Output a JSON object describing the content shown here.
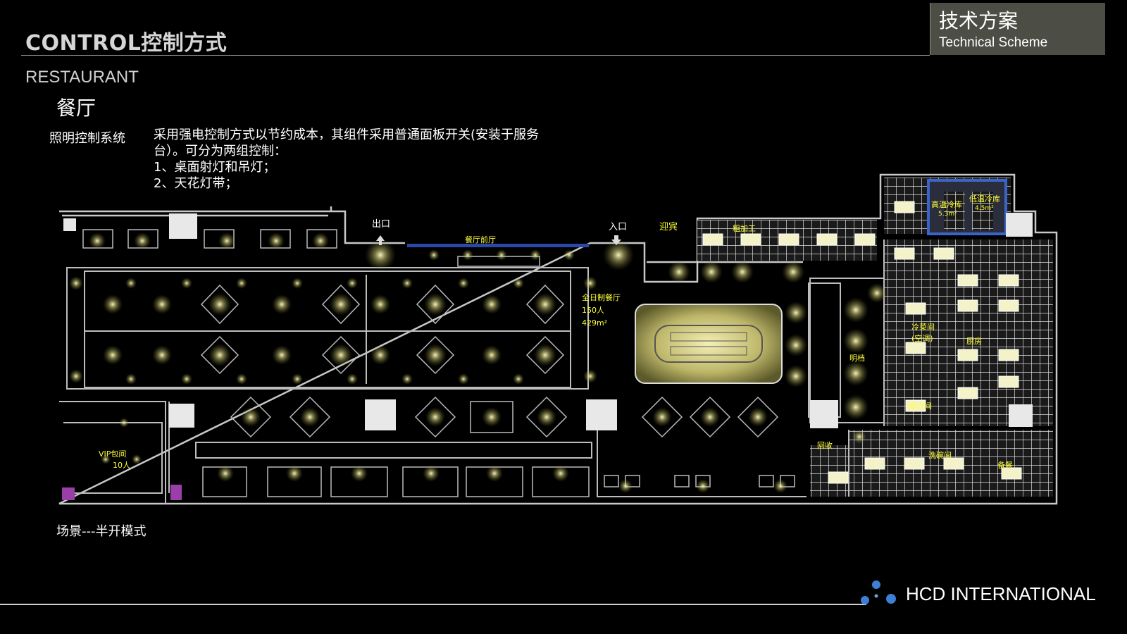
{
  "header": {
    "title": "CONTROL控制方式",
    "badge_cn": "技术方案",
    "badge_en": "Technical Scheme"
  },
  "section": {
    "en": "RESTAURANT",
    "cn": "餐厅"
  },
  "lighting": {
    "label": "照明控制系统",
    "lines": [
      "采用强电控制方式以节约成本，其组件采用普通面板开关(安装于服务",
      "台）。可分为两组控制：",
      "1、桌面射灯和吊灯；",
      "2、天花灯带；"
    ]
  },
  "plan_labels": {
    "exit": "出口",
    "entrance": "入口",
    "welcome": "迎宾",
    "lobby": "餐厅前厅",
    "allday": "全日制餐厅",
    "capacity": "150人",
    "area": "429m²",
    "vip": "VIP包间",
    "vip_cap": "10人",
    "open_kitchen": "明档",
    "high_cold": "高温冷库",
    "low_cold": "低温冷库",
    "high_cold_area": "5.3m²",
    "low_cold_area": "4.5m²",
    "rough": "粗加工",
    "cold_room": "冷菜间",
    "cold_room_note": "(空调)",
    "kitchen": "厨房",
    "noodle": "面点间",
    "return": "回收",
    "wash": "洗碗间",
    "store": "备餐"
  },
  "scene": {
    "label": "场景---半开模式"
  },
  "footer": {
    "brand": "HCD INTERNATIONAL"
  },
  "colors": {
    "wall": "#c8c8c8",
    "glow": "#e9e89a",
    "label": "#ffff3a",
    "badge": "#4c4e45",
    "logo": "#3d7fd4"
  }
}
